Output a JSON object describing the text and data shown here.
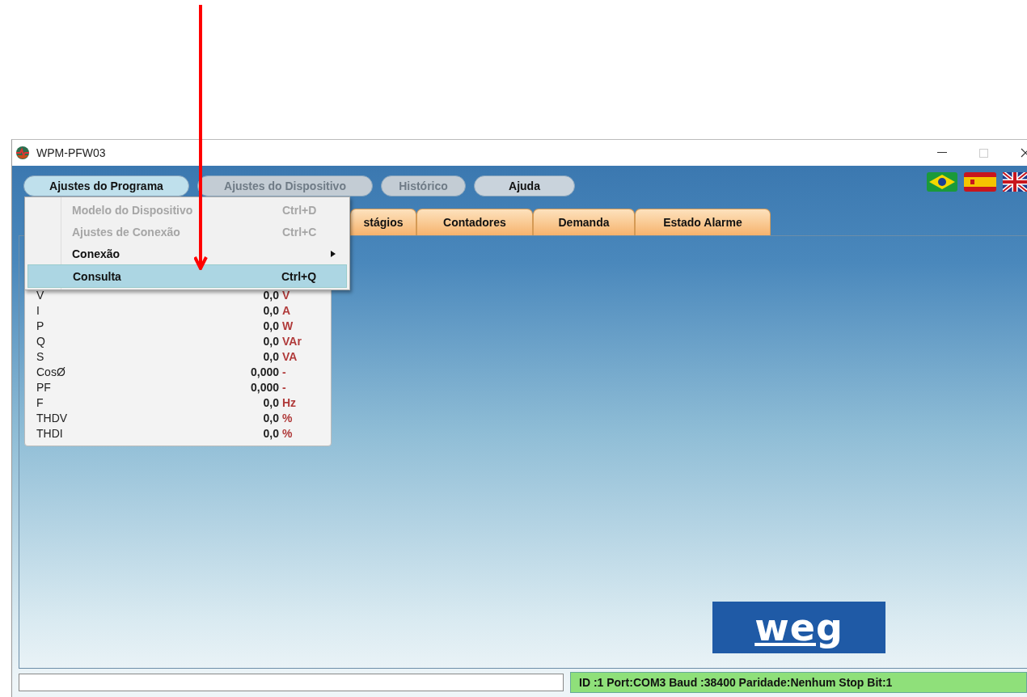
{
  "window": {
    "title": "WPM-PFW03"
  },
  "menu_bar": [
    {
      "label": "Ajustes do Programa",
      "selected": true,
      "disabled": false
    },
    {
      "label": "Ajustes do Dispositivo",
      "selected": false,
      "disabled": true
    },
    {
      "label": "Histórico",
      "selected": false,
      "disabled": true
    },
    {
      "label": "Ajuda",
      "selected": false,
      "disabled": false
    }
  ],
  "dropdown": [
    {
      "label": "Modelo do Dispositivo",
      "shortcut": "Ctrl+D",
      "disabled": true,
      "submenu": false,
      "selected": false
    },
    {
      "label": "Ajustes de Conexão",
      "shortcut": "Ctrl+C",
      "disabled": true,
      "submenu": false,
      "selected": false
    },
    {
      "label": "Conexão",
      "disabled": false,
      "submenu": true,
      "selected": false
    },
    {
      "label": "Consulta",
      "shortcut": "Ctrl+Q",
      "disabled": false,
      "submenu": false,
      "selected": true
    }
  ],
  "tabs": [
    {
      "label": "stágios"
    },
    {
      "label": "Contadores"
    },
    {
      "label": "Demanda"
    },
    {
      "label": "Estado Alarme"
    }
  ],
  "measurements": [
    {
      "name": "V",
      "value": "0,0",
      "unit": "V"
    },
    {
      "name": "I",
      "value": "0,0",
      "unit": "A"
    },
    {
      "name": "P",
      "value": "0,0",
      "unit": "W"
    },
    {
      "name": "Q",
      "value": "0,0",
      "unit": "VAr"
    },
    {
      "name": "S",
      "value": "0,0",
      "unit": "VA"
    },
    {
      "name": "CosØ",
      "value": "0,000",
      "unit": "-"
    },
    {
      "name": "PF",
      "value": "0,000",
      "unit": "-"
    },
    {
      "name": "F",
      "value": "0,0",
      "unit": "Hz"
    },
    {
      "name": "THDV",
      "value": "0,0",
      "unit": "%"
    },
    {
      "name": "THDI",
      "value": "0,0",
      "unit": "%"
    }
  ],
  "logo": {
    "text": "weg"
  },
  "status_bar": {
    "right": "ID :1 Port:COM3 Baud :38400 Paridade:Nenhum Stop Bit:1"
  }
}
